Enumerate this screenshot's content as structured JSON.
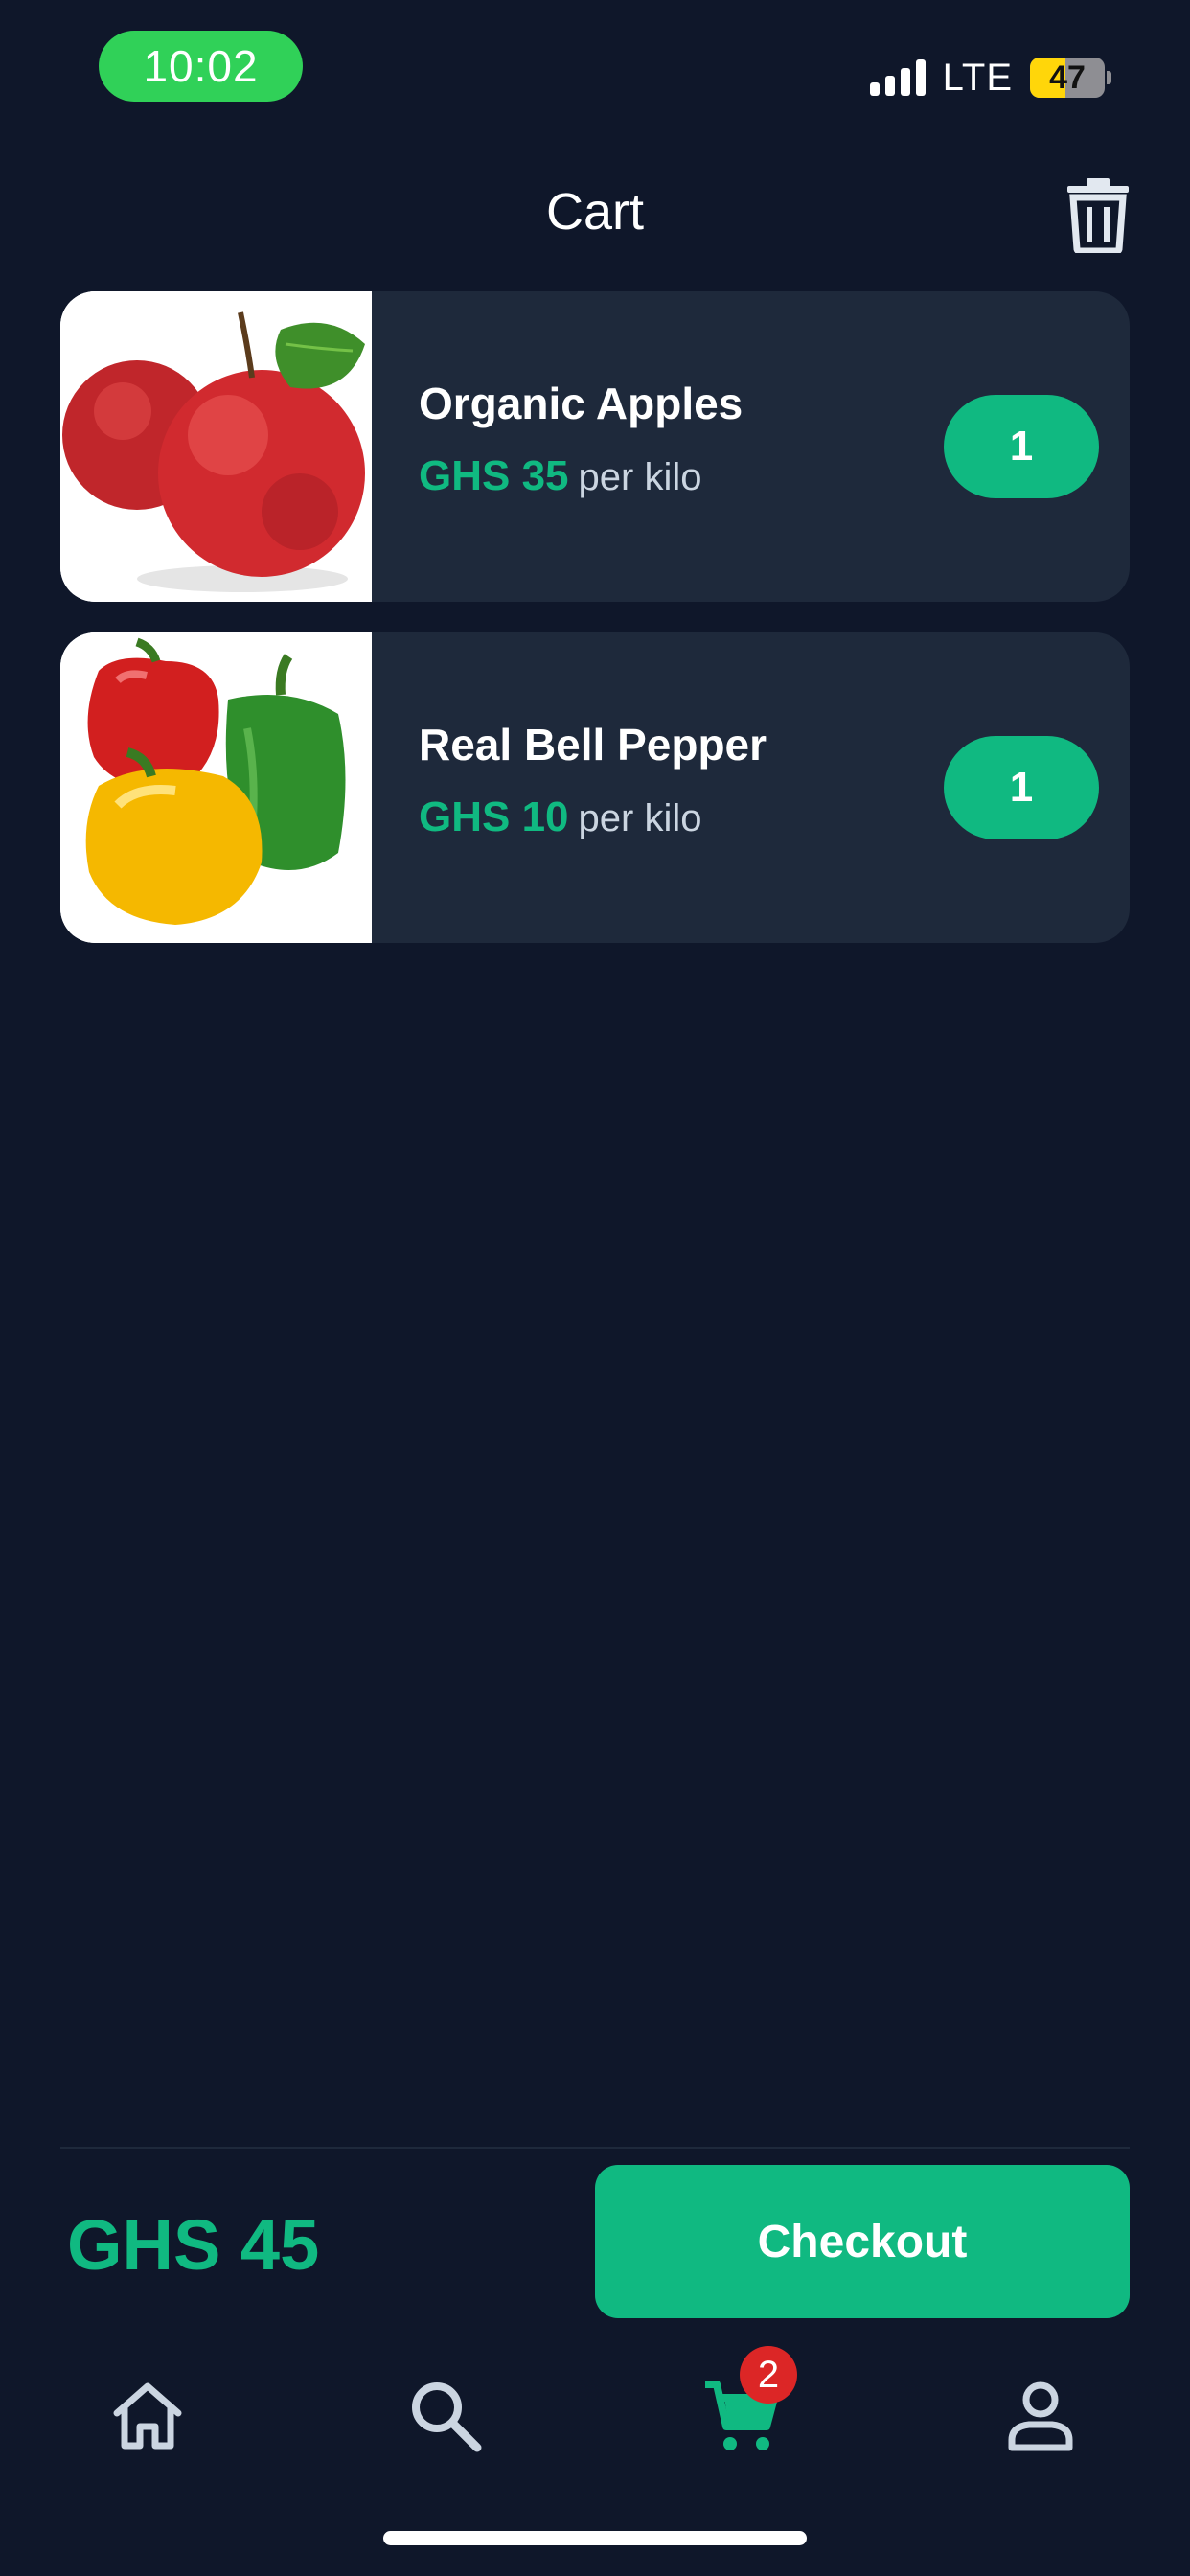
{
  "status_bar": {
    "time": "10:02",
    "network": "LTE",
    "battery_percent": "47",
    "battery_level": 0.47
  },
  "header": {
    "title": "Cart",
    "trash_icon": "trash-icon"
  },
  "cart": {
    "items": [
      {
        "name": "Organic Apples",
        "price": "GHS 35",
        "unit": "per kilo",
        "quantity": "1",
        "image": "apples-image"
      },
      {
        "name": "Real Bell Pepper",
        "price": "GHS 10",
        "unit": "per kilo",
        "quantity": "1",
        "image": "bell-peppers-image"
      }
    ]
  },
  "footer": {
    "total": "GHS 45",
    "checkout_label": "Checkout"
  },
  "bottom_nav": {
    "items": [
      {
        "icon": "home-icon",
        "active": false
      },
      {
        "icon": "search-icon",
        "active": false
      },
      {
        "icon": "cart-icon",
        "active": true,
        "badge": "2"
      },
      {
        "icon": "profile-icon",
        "active": false
      }
    ]
  },
  "colors": {
    "background": "#0f172a",
    "card": "#1e293b",
    "accent": "#10b981",
    "badge": "#dc2626",
    "time_pill": "#30d158",
    "battery": "#ffd60a"
  }
}
